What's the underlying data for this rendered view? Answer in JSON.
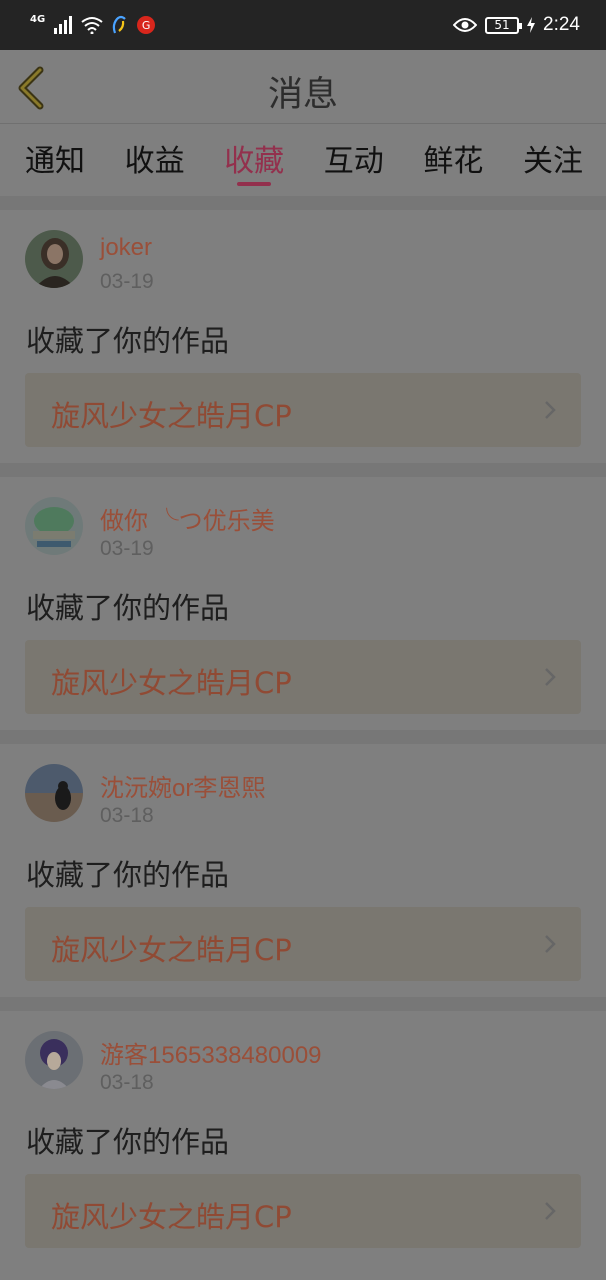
{
  "status_bar": {
    "network": "4G",
    "notify_badge": "G",
    "battery": "51",
    "time": "2:24"
  },
  "header": {
    "title": "消息"
  },
  "tabs": [
    {
      "label": "通知",
      "active": false
    },
    {
      "label": "收益",
      "active": false
    },
    {
      "label": "收藏",
      "active": true
    },
    {
      "label": "互动",
      "active": false
    },
    {
      "label": "鲜花",
      "active": false
    },
    {
      "label": "关注",
      "active": false
    }
  ],
  "messages": [
    {
      "user": "joker",
      "date": "03-19",
      "action": "收藏了你的作品",
      "work": "旋风少女之皓月CP"
    },
    {
      "user": "做你 ╰つ优乐美",
      "date": "03-19",
      "action": "收藏了你的作品",
      "work": "旋风少女之皓月CP"
    },
    {
      "user": "沈沅婉or李恩熙",
      "date": "03-18",
      "action": "收藏了你的作品",
      "work": "旋风少女之皓月CP"
    },
    {
      "user": "游客1565338480009",
      "date": "03-18",
      "action": "收藏了你的作品",
      "work": "旋风少女之皓月CP"
    }
  ],
  "colors": {
    "accent": "#93304d",
    "username": "#9a4f39",
    "work_title": "#904a34"
  }
}
